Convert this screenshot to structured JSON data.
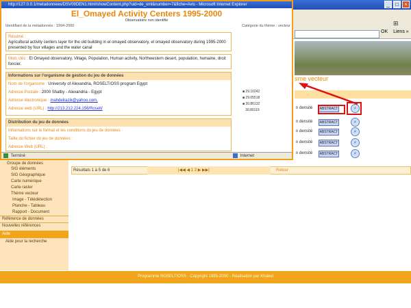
{
  "background_window": {
    "title": "",
    "menu": [],
    "address": "",
    "go_label": "OK",
    "links_label": "Liens",
    "page_title": "sme vecteur",
    "vector_rows": [
      {
        "label": "n densité",
        "abstract_label": "ABSTRACT"
      },
      {
        "label": "n densité",
        "abstract_label": "ABSTRACT"
      },
      {
        "label": "n densité",
        "abstract_label": "ABSTRACT"
      },
      {
        "label": "n densité",
        "abstract_label": "ABSTRACT"
      },
      {
        "label": "n densité",
        "abstract_label": "ABSTRACT"
      }
    ],
    "sidebar": [
      "Groupe de données",
      "SIG éléments",
      "SIG Géographique",
      "Carte numérique",
      "Carte raster",
      "Thème vecteur",
      "Image - Télédétection",
      "Planche - Tableau",
      "Rapport - Document",
      "Référence de données",
      "Nouvelles références",
      "Aide",
      "Aide pour la recherche"
    ],
    "pager_left": "Résultats 1 à 5 de 6",
    "pager_nav": "|◀◀  ◀  1  2  ▶  ▶▶|",
    "pager_right": "Retour",
    "footer": "Programme ROSELT/OSS - Copyright 1995-2000 - Réalisation par Khaled"
  },
  "popup": {
    "title_bar": "http://127.0.0.1/metadonnees/DSV09DEN1.html/showContent.php?uid=de_xml&number=7&fiche=Avis - Microsoft Internet Explorer",
    "heading": "El_Omayed Activity Centers 1995-2000",
    "subheading": "Observatoire non identifié",
    "meta_left": "Identifiant de la métadonnée : 1994-2000",
    "meta_right": "Catégorie du thème : vecteur",
    "resume_label": "Résumé :",
    "resume_text": "Agricultural activity centers layer for the old building in el omayed observatory, el omayed observatory during 1995-2000 presented by four villages and the water canal",
    "keywords_label": "Mots clés :",
    "keywords_text": "El Omayed observatory, Village, Population, Human activity, Northwestern desert, population, humaine, droit foncier.",
    "org_section_title": "Informations sur l'organisme de gestion du jeu de données",
    "org_name_label": "Nom de l'organisme :",
    "org_name_value": "University of Alexandria, ROSELT/OSS program Egypt",
    "address_label": "Adresse Postale :",
    "address_value": "2000 Shatby - Alexandria - Egypt",
    "email_label": "Adresse électronique :",
    "email_value": "mahdelrazik@yahoo.com,",
    "web_label": "Adresse web (URL) :",
    "web_value": "http://213.212.224.156/Roselt/",
    "coords": [
      "29.10242",
      "29.05518",
      "30.86132",
      "30.80119"
    ],
    "dist_section_title": "Distribution du jeu de données",
    "dist_line1": "Informations sur le format et les conditions du jeu de données :",
    "dist_line2": "Taille du fichier du jeu de données :",
    "dist_line3": "Adresse Web (URL) :",
    "status_left": "Terminé",
    "status_right": "Internet"
  }
}
